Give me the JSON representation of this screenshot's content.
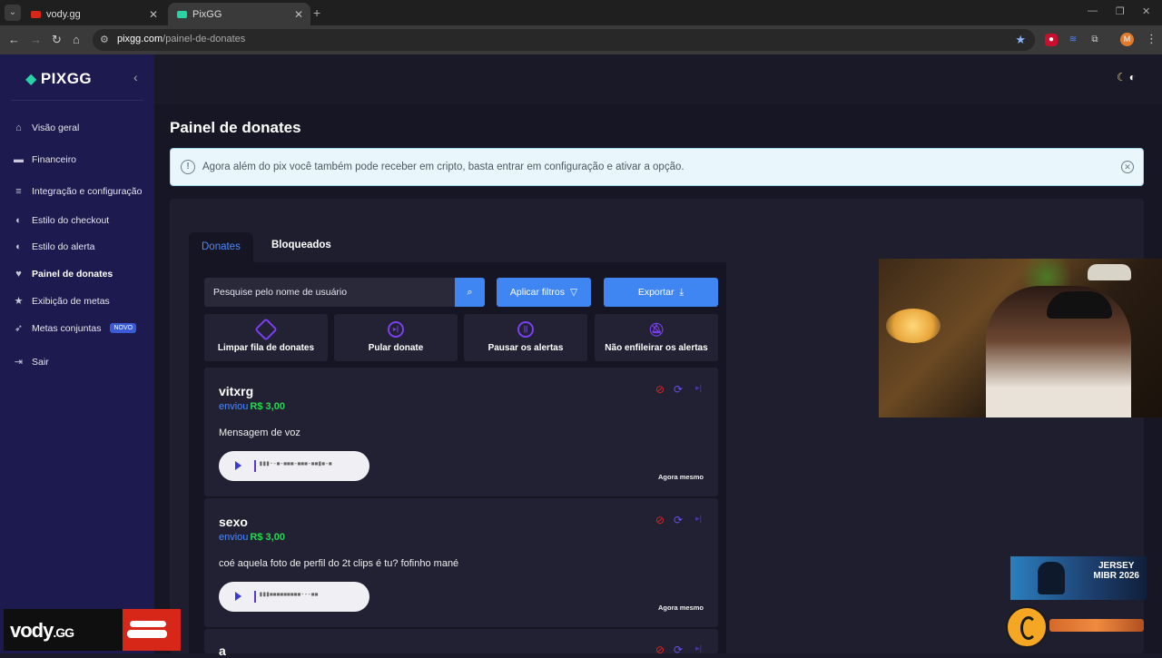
{
  "browser": {
    "tabs": [
      {
        "title": "vody.gg",
        "active": false
      },
      {
        "title": "PixGG",
        "active": true
      }
    ],
    "url_host": "pixgg.com",
    "url_path": "/painel-de-donates",
    "profile_initial": "M"
  },
  "sidebar": {
    "brand": "PIXGG",
    "items": [
      {
        "label": "Visão geral",
        "icon": "home-icon"
      },
      {
        "label": "Financeiro",
        "icon": "wallet-icon"
      },
      {
        "label": "Integração e configuração",
        "icon": "settings-icon"
      },
      {
        "label": "Estilo do checkout",
        "icon": "palette-icon"
      },
      {
        "label": "Estilo do alerta",
        "icon": "palette-icon"
      },
      {
        "label": "Painel de donates",
        "icon": "hand-heart-icon",
        "active": true
      },
      {
        "label": "Exibição de metas",
        "icon": "star-icon"
      },
      {
        "label": "Metas conjuntas",
        "icon": "rocket-icon",
        "badge": "NOVO"
      },
      {
        "label": "Sair",
        "icon": "logout-icon"
      }
    ]
  },
  "page": {
    "title": "Painel de donates",
    "alert_text": "Agora além do pix você também pode receber em cripto, basta entrar em configuração e ativar a opção."
  },
  "tabs": {
    "donates": "Donates",
    "blocked": "Bloqueados"
  },
  "toolbar": {
    "search_placeholder": "Pesquise pelo nome de usuário",
    "filter_label": "Aplicar filtros",
    "export_label": "Exportar"
  },
  "actions": [
    {
      "label": "Limpar fila de donates",
      "icon": "eraser-icon"
    },
    {
      "label": "Pular donate",
      "icon": "skip-icon"
    },
    {
      "label": "Pausar os alertas",
      "icon": "pause-icon"
    },
    {
      "label": "Não enfileirar os alertas",
      "icon": "bell-off-icon"
    }
  ],
  "donates": [
    {
      "user": "vitxrg",
      "sent": "enviou",
      "amount": "R$ 3,00",
      "message": "Mensagem de voz",
      "time": "Agora mesmo"
    },
    {
      "user": "sexo",
      "sent": "enviou",
      "amount": "R$ 3,00",
      "message": "coé aquela foto de perfil do 2t clips é tu? fofinho mané",
      "time": "Agora mesmo"
    },
    {
      "user": "a"
    }
  ],
  "overlay": {
    "promo_line1": "JERSEY",
    "promo_line2": "MIBR 2026",
    "vody_name": "vody",
    "vody_tld": ".GG"
  },
  "colors": {
    "sidebar_bg": "#1d1a4f",
    "accent_blue": "#3f86f2",
    "amount_green": "#29d653",
    "block_red": "#e02424",
    "purple": "#7a3ff0"
  }
}
